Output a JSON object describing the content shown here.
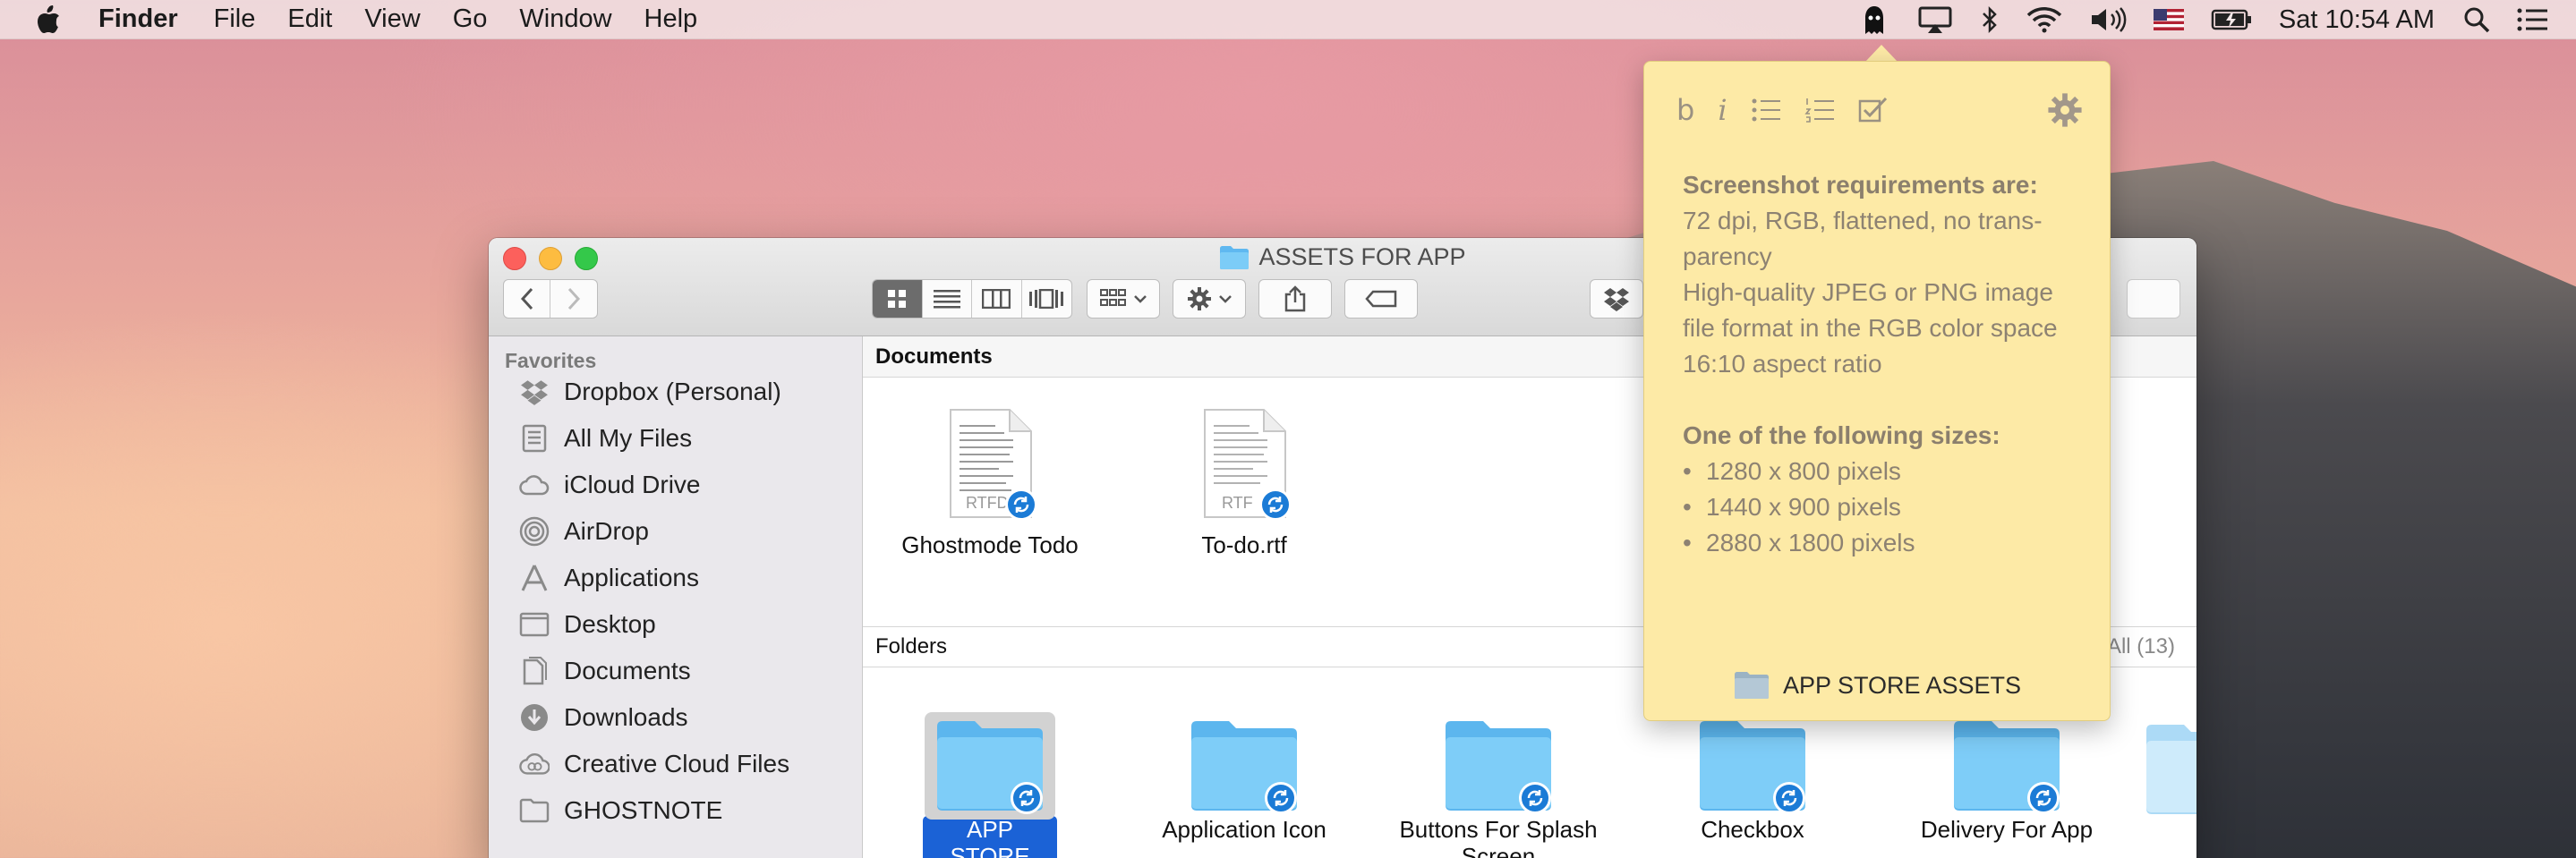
{
  "menubar": {
    "app_name": "Finder",
    "menus": [
      "File",
      "Edit",
      "View",
      "Go",
      "Window",
      "Help"
    ],
    "clock": "Sat 10:54 AM",
    "status_icons": [
      "ghostnote-icon",
      "airplay-icon",
      "bluetooth-icon",
      "wifi-icon",
      "volume-icon",
      "flag-icon",
      "battery-icon",
      "spotlight-icon",
      "notification-center-icon"
    ]
  },
  "window": {
    "title": "ASSETS FOR APP"
  },
  "sidebar": {
    "heading": "Favorites",
    "items": [
      {
        "label": "Dropbox (Personal)",
        "icon": "dropbox-icon"
      },
      {
        "label": "All My Files",
        "icon": "all-files-icon"
      },
      {
        "label": "iCloud Drive",
        "icon": "cloud-icon"
      },
      {
        "label": "AirDrop",
        "icon": "airdrop-icon"
      },
      {
        "label": "Applications",
        "icon": "applications-icon"
      },
      {
        "label": "Desktop",
        "icon": "desktop-icon"
      },
      {
        "label": "Documents",
        "icon": "documents-icon"
      },
      {
        "label": "Downloads",
        "icon": "downloads-icon"
      },
      {
        "label": "Creative Cloud Files",
        "icon": "creative-cloud-icon"
      },
      {
        "label": "GHOSTNOTE",
        "icon": "folder-icon"
      }
    ]
  },
  "documents": {
    "heading": "Documents",
    "files": [
      {
        "name": "Ghostmode Todo",
        "ext": "RTFD"
      },
      {
        "name": "To-do.rtf",
        "ext": "RTF"
      }
    ]
  },
  "folders": {
    "heading": "Folders",
    "show_all": "All (13)",
    "items": [
      {
        "name": "APP STORE ASSETS",
        "selected": true
      },
      {
        "name": "Application Icon",
        "selected": false
      },
      {
        "name": "Buttons For Splash Screen",
        "selected": false
      },
      {
        "name": "Checkbox",
        "selected": false
      },
      {
        "name": "Delivery For App",
        "selected": false
      }
    ]
  },
  "note": {
    "heading1": "Screenshot requirements are:",
    "lines": [
      "72 dpi, RGB, flattened, no trans-",
      "parency",
      "High-quality JPEG or PNG image",
      "file format in the RGB color space",
      "16:10 aspect ratio"
    ],
    "heading2": "One of the following sizes:",
    "bullets": [
      "1280 x 800 pixels",
      "1440 x 900 pixels",
      "2880 x 1800 pixels"
    ],
    "bullet_char": "•",
    "footer_folder": "APP STORE ASSETS",
    "toolbar": {
      "bold": "b",
      "italic": "i"
    }
  },
  "colors": {
    "accent": "#1b62d6",
    "folder_blue": "#6cc4f5",
    "note_bg": "#fdeaa6",
    "sync_badge": "#1b7bd6"
  }
}
